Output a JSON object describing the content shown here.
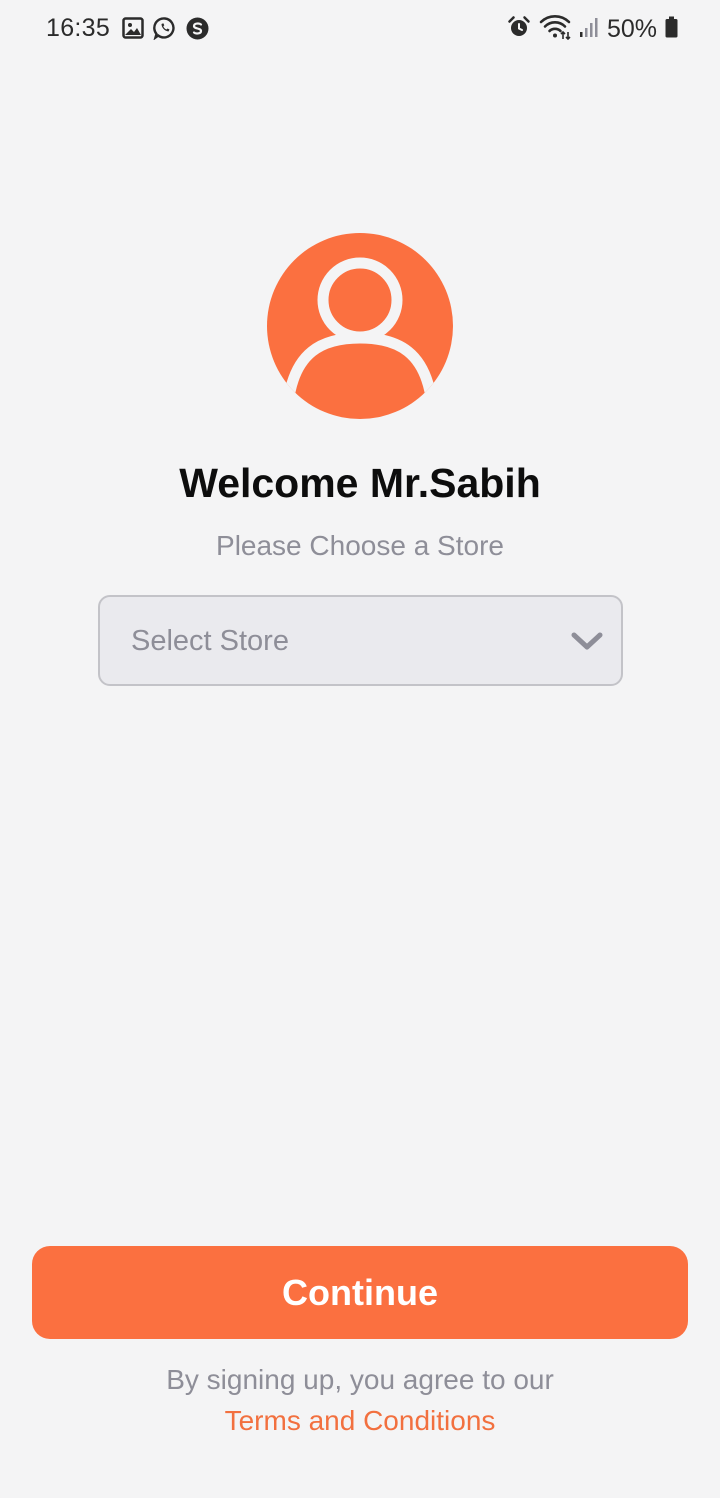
{
  "status_bar": {
    "time": "16:35",
    "battery": "50%",
    "left_icons": [
      "gallery-icon",
      "whatsapp-icon",
      "s-app-icon"
    ],
    "right_icons": [
      "alarm-icon",
      "wifi-icon",
      "signal-icon",
      "battery-icon"
    ]
  },
  "avatar": {
    "icon": "user-icon",
    "color": "#fb7040"
  },
  "welcome": {
    "title": "Welcome Mr.Sabih",
    "subtitle": "Please Choose a Store"
  },
  "store_select": {
    "placeholder": "Select Store",
    "icon": "chevron-down-icon"
  },
  "continue_button": {
    "label": "Continue",
    "color": "#fb7040"
  },
  "footer": {
    "agreement_text": "By signing up, you agree to our",
    "terms_link": "Terms and Conditions",
    "link_color": "#f2703f"
  }
}
